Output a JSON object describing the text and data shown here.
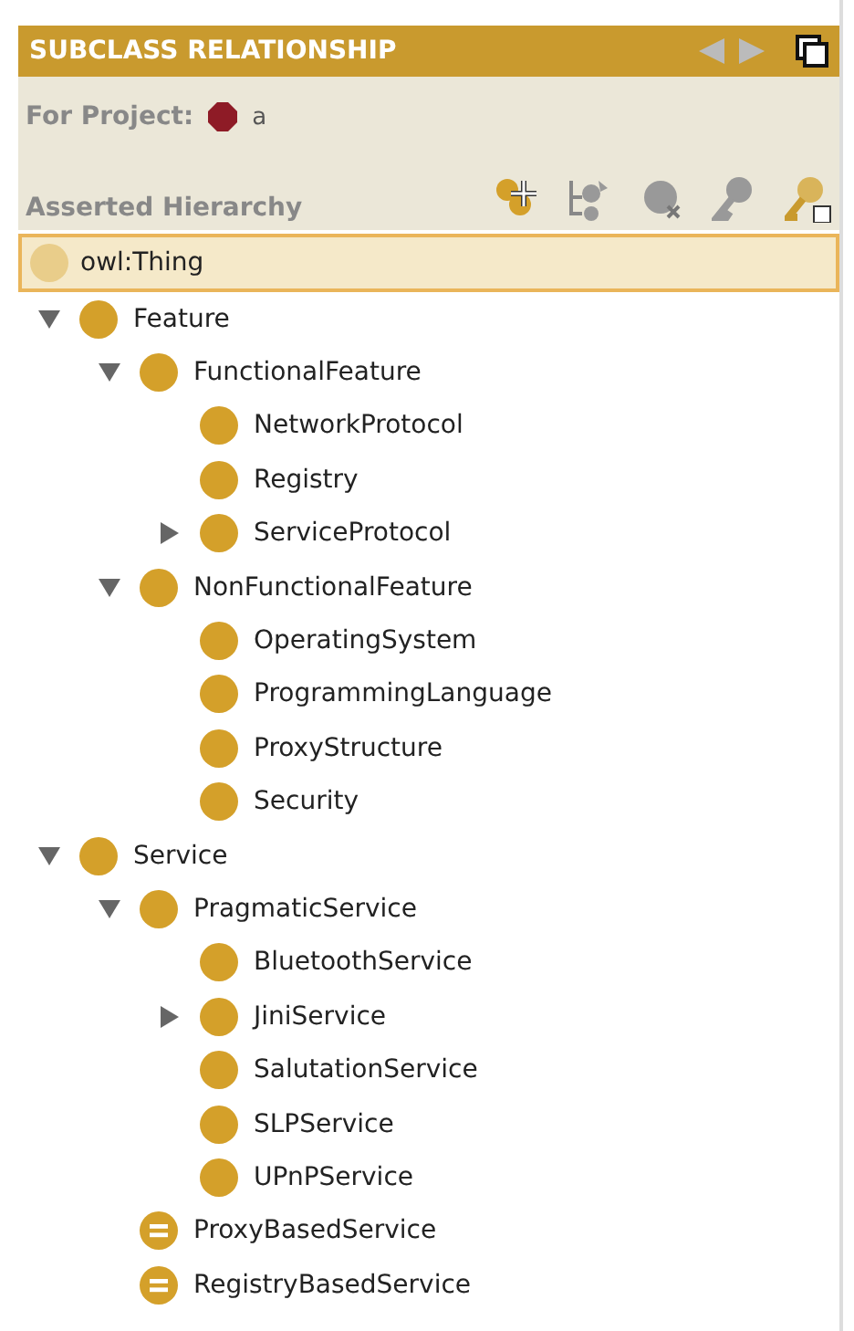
{
  "header": {
    "title": "SUBCLASS RELATIONSHIP"
  },
  "project": {
    "label": "For Project:",
    "name": "a"
  },
  "hierarchy": {
    "title": "Asserted Hierarchy"
  },
  "root": {
    "label": "owl:Thing",
    "selected": true
  },
  "classes": [
    {
      "label": "Feature",
      "kind": "class",
      "expanded": true,
      "children": [
        {
          "label": "FunctionalFeature",
          "kind": "class",
          "expanded": true,
          "children": [
            {
              "label": "NetworkProtocol",
              "kind": "class"
            },
            {
              "label": "Registry",
              "kind": "class"
            },
            {
              "label": "ServiceProtocol",
              "kind": "class",
              "expanded": false
            }
          ]
        },
        {
          "label": "NonFunctionalFeature",
          "kind": "class",
          "expanded": true,
          "children": [
            {
              "label": "OperatingSystem",
              "kind": "class"
            },
            {
              "label": "ProgrammingLanguage",
              "kind": "class"
            },
            {
              "label": "ProxyStructure",
              "kind": "class"
            },
            {
              "label": "Security",
              "kind": "class"
            }
          ]
        }
      ]
    },
    {
      "label": "Service",
      "kind": "class",
      "expanded": true,
      "children": [
        {
          "label": "PragmaticService",
          "kind": "class",
          "expanded": true,
          "children": [
            {
              "label": "BluetoothService",
              "kind": "class"
            },
            {
              "label": "JiniService",
              "kind": "class",
              "expanded": false
            },
            {
              "label": "SalutationService",
              "kind": "class"
            },
            {
              "label": "SLPService",
              "kind": "class"
            },
            {
              "label": "UPnPService",
              "kind": "class"
            }
          ]
        },
        {
          "label": "ProxyBasedService",
          "kind": "defined"
        },
        {
          "label": "RegistryBasedService",
          "kind": "defined"
        }
      ]
    }
  ]
}
